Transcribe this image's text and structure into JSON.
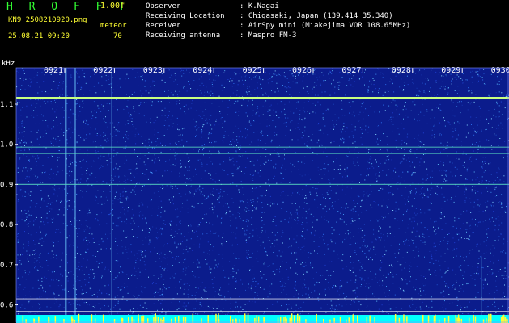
{
  "header": {
    "app_title": "H R O F F T",
    "version": "1.00f",
    "filename": "KN9_2508210920.png",
    "datetime": "25.08.21 09:20",
    "meteo_label": "meteor",
    "meteo_count": "70"
  },
  "info": [
    {
      "label": "Observer",
      "value": ": K.Nagai"
    },
    {
      "label": "Receiving Location",
      "value": ": Chigasaki, Japan (139.414 35.340)"
    },
    {
      "label": "Receiver",
      "value": ": AirSpy mini (Miakejima VOR 108.65MHz)"
    },
    {
      "label": "Receiving antenna",
      "value": ": Maspro FM-3"
    }
  ],
  "chart_data": {
    "type": "heatmap",
    "title": "",
    "ylabel": "kHz",
    "xlabel": "",
    "ylim": [
      0.6,
      1.2
    ],
    "x_ticks": [
      "0921",
      "0922",
      "0923",
      "0924",
      "0925",
      "0926",
      "0927",
      "0928",
      "0929",
      "0930"
    ],
    "y_ticks": [
      1.1,
      1.0,
      0.9,
      0.8,
      0.7,
      0.6
    ],
    "background_color": "#0b1c8c",
    "signal_color": "#c8ff80",
    "horizontal_signals_khz": [
      1.116,
      0.993,
      0.977,
      0.9
    ],
    "reference_lines_khz": [
      0.615,
      0.6
    ]
  }
}
